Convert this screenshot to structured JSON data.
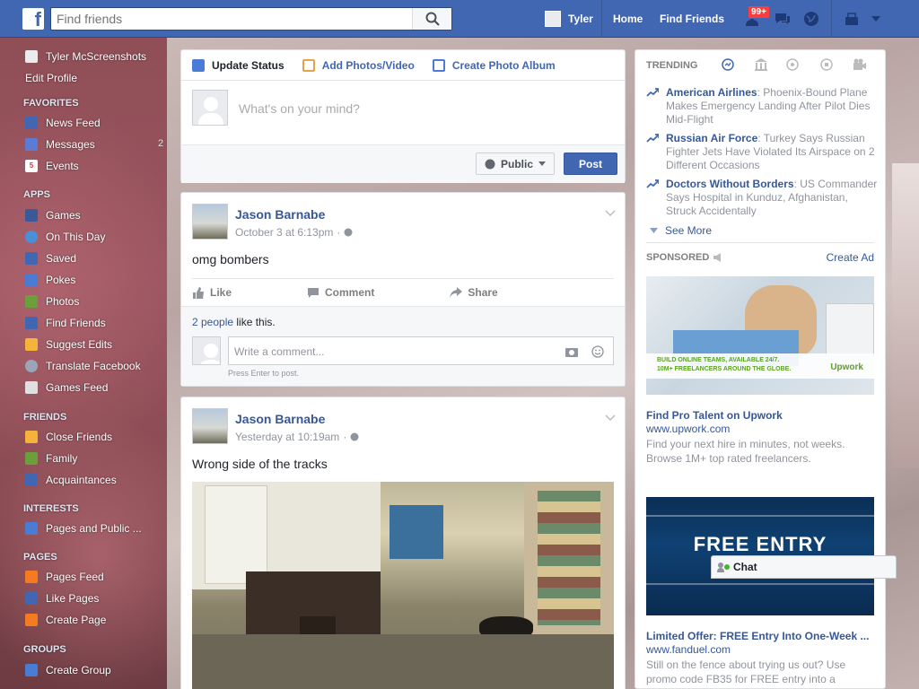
{
  "header": {
    "search_placeholder": "Find friends",
    "user_name": "Tyler",
    "home": "Home",
    "find_friends": "Find Friends",
    "notif_badge": "99+"
  },
  "sidebar": {
    "profile_name": "Tyler McScreenshots",
    "edit_profile": "Edit Profile",
    "sections": [
      {
        "title": "FAVORITES",
        "items": [
          "News Feed",
          "Messages",
          "Events"
        ]
      },
      {
        "title": "APPS",
        "items": [
          "Games",
          "On This Day",
          "Saved",
          "Pokes",
          "Photos",
          "Find Friends",
          "Suggest Edits",
          "Translate Facebook",
          "Games Feed"
        ]
      },
      {
        "title": "FRIENDS",
        "items": [
          "Close Friends",
          "Family",
          "Acquaintances"
        ]
      },
      {
        "title": "INTERESTS",
        "items": [
          "Pages and Public ..."
        ]
      },
      {
        "title": "PAGES",
        "items": [
          "Pages Feed",
          "Like Pages",
          "Create Page"
        ]
      },
      {
        "title": "GROUPS",
        "items": [
          "Create Group"
        ]
      }
    ],
    "events_day": "5",
    "messages_count": "2"
  },
  "composer": {
    "tabs": [
      "Update Status",
      "Add Photos/Video",
      "Create Photo Album"
    ],
    "placeholder": "What's on your mind?",
    "audience": "Public",
    "post_button": "Post"
  },
  "posts": [
    {
      "author": "Jason Barnabe",
      "time": "October 3 at 6:13pm",
      "text": "omg bombers",
      "like": "Like",
      "comment": "Comment",
      "share": "Share",
      "likes_link": "2 people",
      "likes_rest": " like this.",
      "comment_placeholder": "Write a comment...",
      "hint": "Press Enter to post."
    },
    {
      "author": "Jason Barnabe",
      "time": "Yesterday at 10:19am",
      "text": "Wrong side of the tracks"
    }
  ],
  "trending": {
    "title": "TRENDING",
    "items": [
      {
        "topic": "American Airlines",
        "desc": ": Phoenix-Bound Plane Makes Emergency Landing After Pilot Dies Mid-Flight"
      },
      {
        "topic": "Russian Air Force",
        "desc": ": Turkey Says Russian Fighter Jets Have Violated Its Airspace on 2 Different Occasions"
      },
      {
        "topic": "Doctors Without Borders",
        "desc": ": US Commander Says Hospital in Kunduz, Afghanistan, Struck Accidentally"
      }
    ],
    "see_more": "See More"
  },
  "sponsored": {
    "title": "SPONSORED",
    "create_ad": "Create Ad",
    "ads": [
      {
        "banner_text1": "BUILD ONLINE TEAMS, AVAILABLE 24/7.",
        "banner_text2": "10M+ FREELANCERS AROUND THE GLOBE.",
        "brand": "Upwork",
        "title": "Find Pro Talent on Upwork",
        "url": "www.upwork.com",
        "desc": "Find your next hire in minutes, not weeks. Browse 1M+ top rated freelancers."
      },
      {
        "banner_text": "FREE ENTRY",
        "title": "Limited Offer: FREE Entry Into One-Week ...",
        "url": "www.fanduel.com",
        "desc": "Still on the fence about trying us out? Use promo code FB35 for FREE entry into a"
      }
    ]
  },
  "chat": {
    "label": "Chat"
  }
}
